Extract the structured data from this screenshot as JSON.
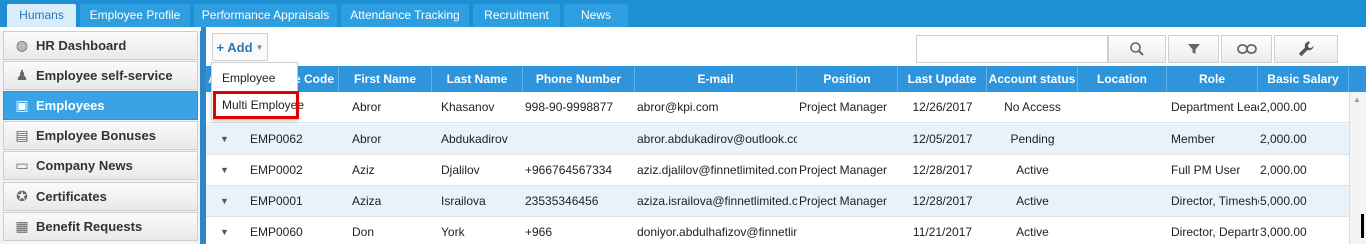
{
  "top_tabs": [
    {
      "label": "Humans",
      "active": true
    },
    {
      "label": "Employee Profile",
      "active": false
    },
    {
      "label": "Performance Appraisals",
      "active": false
    },
    {
      "label": "Attendance Tracking",
      "active": false
    },
    {
      "label": "Recruitment",
      "active": false
    },
    {
      "label": "News",
      "active": false
    }
  ],
  "sidebar": {
    "items": [
      {
        "label": "HR Dashboard",
        "icon": "dashboard-icon",
        "active": false
      },
      {
        "label": "Employee self-service",
        "icon": "person-icon",
        "active": false
      },
      {
        "label": "Employees",
        "icon": "employees-icon",
        "active": true
      },
      {
        "label": "Employee Bonuses",
        "icon": "bonus-icon",
        "active": false
      },
      {
        "label": "Company News",
        "icon": "news-icon",
        "active": false
      },
      {
        "label": "Certificates",
        "icon": "certificate-icon",
        "active": false
      },
      {
        "label": "Benefit Requests",
        "icon": "benefit-icon",
        "active": false
      }
    ]
  },
  "toolbar": {
    "add_label": "+ Add",
    "search_placeholder": "",
    "icons": [
      "search-icon",
      "filter-icon",
      "link-icon",
      "wrench-icon"
    ]
  },
  "add_menu": {
    "items": [
      "Employee",
      "Multi Employee"
    ],
    "highlighted_index": 1
  },
  "grid": {
    "columns": [
      "A",
      "e Code",
      "First Name",
      "Last Name",
      "Phone Number",
      "E-mail",
      "Position",
      "Last Update",
      "Account status",
      "Location",
      "Role",
      "Basic Salary"
    ],
    "rows": [
      {
        "code": "",
        "first": "Abror",
        "last": "Khasanov",
        "phone": "998-90-9998877",
        "email": "abror@kpi.com",
        "position": "Project Manager",
        "updated": "12/26/2017",
        "status": "No Access",
        "location": "",
        "role": "Department Leade",
        "salary": "2,000.00"
      },
      {
        "code": "EMP0062",
        "first": "Abror",
        "last": "Abdukadirov",
        "phone": "",
        "email": "abror.abdukadirov@outlook.com",
        "position": "",
        "updated": "12/05/2017",
        "status": "Pending",
        "location": "",
        "role": "Member",
        "salary": "2,000.00"
      },
      {
        "code": "EMP0002",
        "first": "Aziz",
        "last": "Djalilov",
        "phone": "+966764567334",
        "email": "aziz.djalilov@finnetlimited.com",
        "position": "Project Manager",
        "updated": "12/28/2017",
        "status": "Active",
        "location": "",
        "role": "Full PM User",
        "salary": "2,000.00"
      },
      {
        "code": "EMP0001",
        "first": "Aziza",
        "last": "Israilova",
        "phone": "23535346456",
        "email": "aziza.israilova@finnetlimited.com",
        "position": "Project Manager",
        "updated": "12/28/2017",
        "status": "Active",
        "location": "",
        "role": "Director, Timeshee",
        "salary": "5,000.00"
      },
      {
        "code": "EMP0060",
        "first": "Don",
        "last": "York",
        "phone": "+966",
        "email": "doniyor.abdulhafizov@finnetlimite",
        "position": "",
        "updated": "11/21/2017",
        "status": "Active",
        "location": "",
        "role": "Director, Departme",
        "salary": "3,000.00"
      }
    ]
  },
  "colors": {
    "accent": "#2e95dc",
    "highlight_border": "#e00000",
    "row_alt": "#e8f2fb"
  }
}
